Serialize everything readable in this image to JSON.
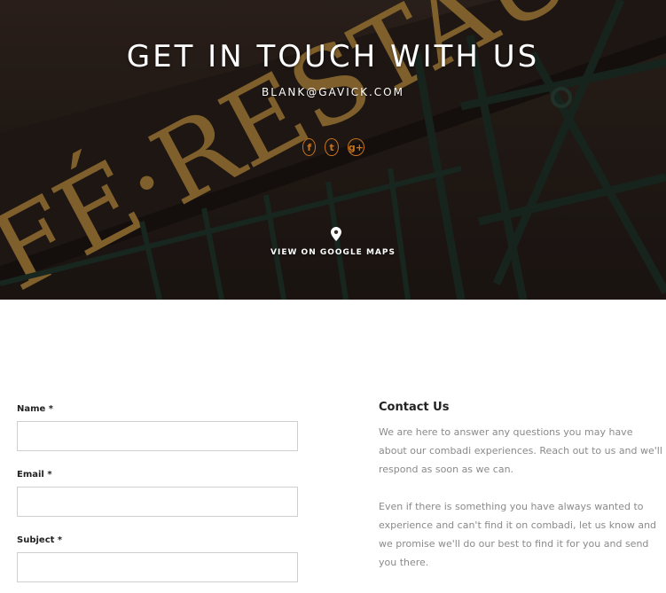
{
  "hero": {
    "title": "GET IN TOUCH WITH US",
    "email": "BLANK@GAVICK.COM",
    "social": [
      {
        "icon": "facebook-icon",
        "glyph": "f"
      },
      {
        "icon": "twitter-icon",
        "glyph": "t"
      },
      {
        "icon": "google-plus-icon",
        "glyph": "g+"
      }
    ],
    "map_icon": "map-pin-icon",
    "maps_link": "VIEW ON GOOGLE MAPS",
    "sign_text": "FÉ·RESTAU",
    "colors": {
      "accent": "#c8741d",
      "sign_text": "#b98a3e",
      "frame": "#1f3329"
    }
  },
  "form": {
    "fields": [
      {
        "label": "Name *",
        "value": "",
        "placeholder": ""
      },
      {
        "label": "Email *",
        "value": "",
        "placeholder": ""
      },
      {
        "label": "Subject *",
        "value": "",
        "placeholder": ""
      }
    ]
  },
  "info": {
    "title": "Contact Us",
    "paragraphs": [
      "We are here to answer any questions you may have about our combadi experiences. Reach out to us and we'll respond as soon as we can.",
      "Even if there is something you have always wanted to experience and can't find it on combadi, let us know and we promise we'll do our best to find it for you and send you there."
    ]
  }
}
